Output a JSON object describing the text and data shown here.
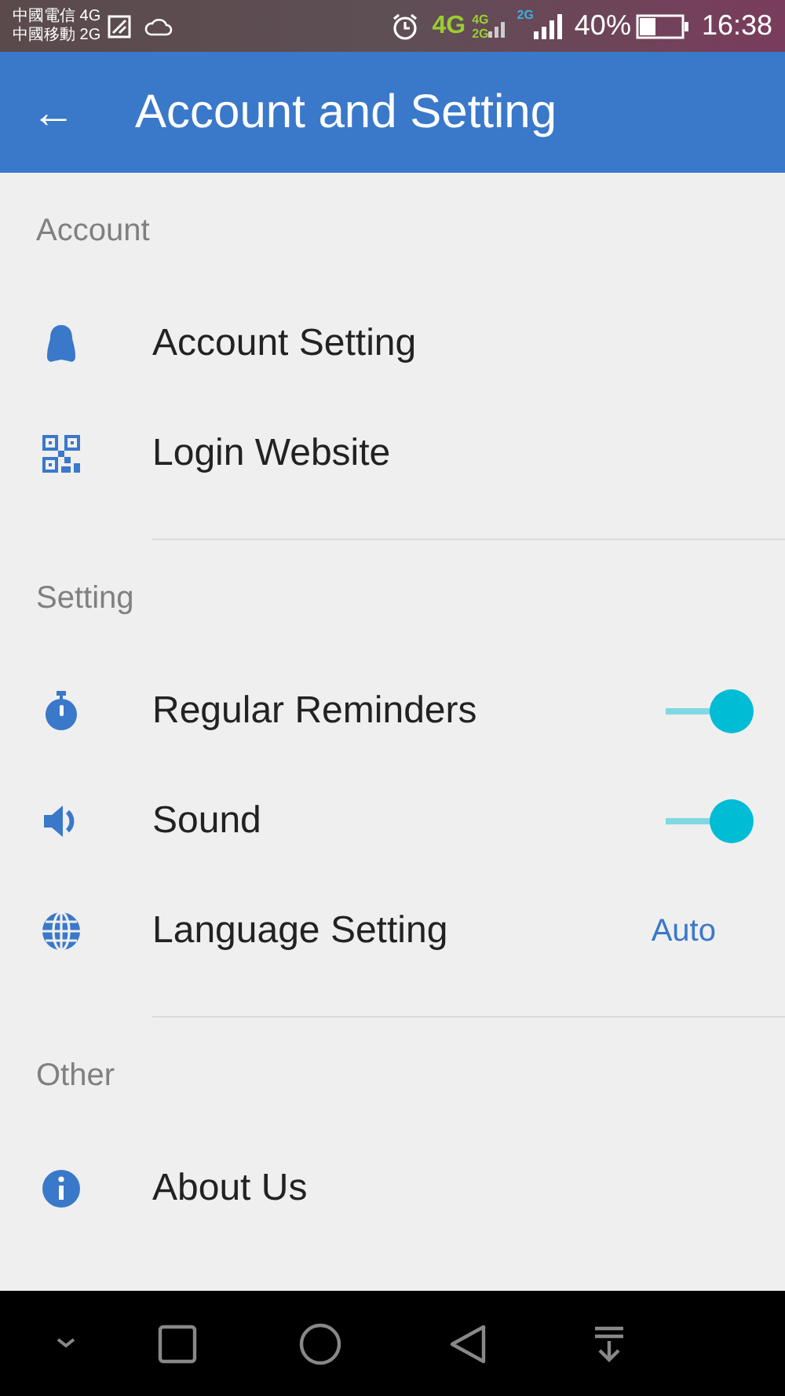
{
  "status_bar": {
    "carriers": [
      "中國電信 4G",
      "中國移動 2G"
    ],
    "network_main": "4G",
    "network_dual": [
      "4G",
      "2G"
    ],
    "network_second": "2G",
    "battery": "40%",
    "time": "16:38"
  },
  "app_bar": {
    "back": "←",
    "title": "Account and Setting"
  },
  "sections": [
    {
      "header": "Account",
      "items": [
        {
          "label": "Account Setting",
          "kind": "link"
        },
        {
          "label": "Login Website",
          "kind": "link"
        }
      ]
    },
    {
      "header": "Setting",
      "items": [
        {
          "label": "Regular Reminders",
          "kind": "toggle",
          "on": true
        },
        {
          "label": "Sound",
          "kind": "toggle",
          "on": true
        },
        {
          "label": "Language Setting",
          "kind": "value",
          "value": "Auto"
        }
      ]
    },
    {
      "header": "Other",
      "items": [
        {
          "label": "About Us",
          "kind": "link"
        }
      ]
    }
  ]
}
